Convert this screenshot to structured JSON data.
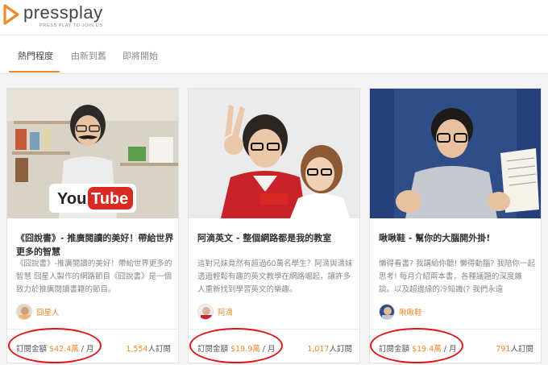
{
  "header": {
    "logo_word": "pressplay",
    "logo_tag": "PRESS PLAY TO JOIN US"
  },
  "tabs": [
    {
      "label": "熱門程度",
      "active": true
    },
    {
      "label": "由新到舊",
      "active": false
    },
    {
      "label": "即將開始",
      "active": false
    }
  ],
  "cards": [
    {
      "title": "《囧說書》- 推廣閱讀的美好！帶給世界更多的智慧",
      "desc": "《囧說書》-推廣閱讀的美好！帶給世界更多的智慧 囧星人製作的網路節目《囧說書》是一個致力於推廣閱讀書籍的節目。",
      "author": "囧星人",
      "price_label": "訂閱金額",
      "price": "$42.4萬",
      "per_month": "/ 月",
      "subs_count": "1,554",
      "subs_label": "人訂閱",
      "image_text": "YouTube"
    },
    {
      "title": "阿滴英文 - 整個網路都是我的教室",
      "desc": "這對兄妹竟然有超過60萬名學生？阿滴與滴妹透過輕鬆有趣的英文教學在網路崛起，讓許多人重新找到學習英文的樂趣。",
      "author": "阿滴",
      "price_label": "訂閱金額",
      "price": "$19.9萬",
      "per_month": "/ 月",
      "subs_count": "1,017",
      "subs_label": "人訂閱"
    },
    {
      "title": "啾啾鞋 - 幫你的大腦開外掛!",
      "desc": "懶得看書? 我講給你聽! 懶得動腦? 我陪你一起思考! 每月介紹兩本書，各種議題的深度雜談。以及超邊緣的冷知識(? 我們永遠",
      "author": "啾啾鞋",
      "price_label": "訂閱金額",
      "price": "$19.4萬",
      "per_month": "/ 月",
      "subs_count": "791",
      "subs_label": "人訂閱"
    }
  ],
  "colors": {
    "accent": "#f08a2e",
    "annotation": "#e0141b"
  }
}
